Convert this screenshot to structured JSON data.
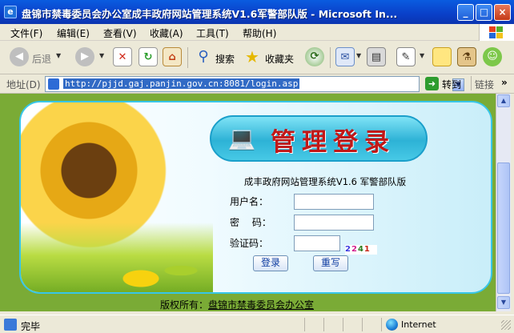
{
  "window": {
    "title": "盘锦市禁毒委员会办公室成丰政府网站管理系统V1.6军警部队版 - Microsoft In...",
    "icon": "ie-page-icon",
    "controls": [
      "minimize",
      "maximize",
      "close"
    ]
  },
  "menu": {
    "items": [
      "文件(F)",
      "编辑(E)",
      "查看(V)",
      "收藏(A)",
      "工具(T)",
      "帮助(H)"
    ]
  },
  "toolbar": {
    "back_label": "后退",
    "search_label": "搜索",
    "favorites_label": "收藏夹"
  },
  "address": {
    "label": "地址(D)",
    "url": "http://pjjd.gaj.panjin.gov.cn:8081/login.asp",
    "go_label": "转到",
    "links_label": "链接",
    "links_chevron": "»"
  },
  "login": {
    "banner": "管理登录",
    "system_name": "成丰政府网站管理系统V1.6 军警部队版",
    "username_label": "用户名：",
    "password_label": "密　 码：",
    "captcha_label": "验证码：",
    "captcha_chars": [
      "2",
      "2",
      "4",
      "1"
    ],
    "captcha_colors": [
      "#3a3adf",
      "#d21e8f",
      "#2a7d1e",
      "#c8281a"
    ],
    "login_button": "登录",
    "reset_button": "重写"
  },
  "footer": {
    "copyright_prefix": "版权所有：",
    "copyright_link": "盘锦市禁毒委员会办公室"
  },
  "status": {
    "text": "完毕",
    "zone": "Internet"
  },
  "colors": {
    "titlebar": "#0a5ce0",
    "page_background": "#7aab36",
    "panel_border": "#37c6e8",
    "banner_text": "#c01818"
  }
}
